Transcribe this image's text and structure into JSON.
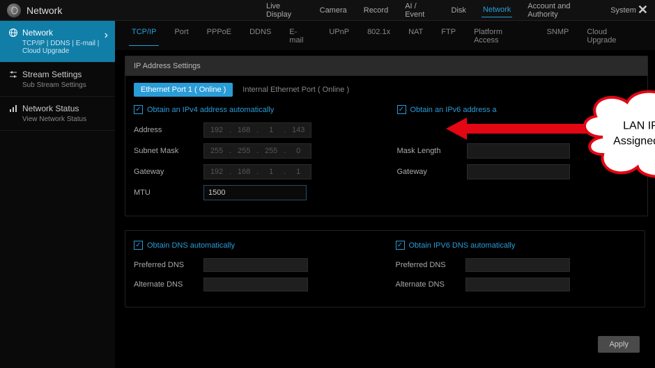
{
  "header": {
    "title": "Network",
    "menu": [
      "Live Display",
      "Camera",
      "Record",
      "AI / Event",
      "Disk",
      "Network",
      "Account and Authority",
      "System"
    ],
    "active_menu": "Network"
  },
  "sidebar": {
    "items": [
      {
        "title": "Network",
        "sub": "TCP/IP | DDNS | E-mail | Cloud Upgrade",
        "active": true,
        "icon": "globe"
      },
      {
        "title": "Stream Settings",
        "sub": "Sub Stream Settings",
        "active": false,
        "icon": "sliders"
      },
      {
        "title": "Network Status",
        "sub": "View Network Status",
        "active": false,
        "icon": "bars"
      }
    ]
  },
  "subtabs": {
    "items": [
      "TCP/IP",
      "Port",
      "PPPoE",
      "DDNS",
      "E-mail",
      "UPnP",
      "802.1x",
      "NAT",
      "FTP",
      "Platform Access",
      "SNMP",
      "Cloud Upgrade"
    ],
    "active": "TCP/IP"
  },
  "panel": {
    "title": "IP Address Settings",
    "port_tabs": {
      "active": "Ethernet Port 1 ( Online )",
      "inactive": "Internal Ethernet Port ( Online )"
    },
    "ipv4": {
      "checkbox": "Obtain an IPv4 address automatically",
      "address_label": "Address",
      "address": [
        "192",
        "168",
        "1",
        "143"
      ],
      "subnet_label": "Subnet Mask",
      "subnet": [
        "255",
        "255",
        "255",
        "0"
      ],
      "gateway_label": "Gateway",
      "gateway": [
        "192",
        "168",
        "1",
        "1"
      ],
      "mtu_label": "MTU",
      "mtu": "1500"
    },
    "ipv6": {
      "checkbox": "Obtain an IPv6 address a",
      "mask_label": "Mask Length",
      "gateway_label": "Gateway"
    }
  },
  "dns": {
    "ipv4": {
      "checkbox": "Obtain DNS automatically",
      "pref_label": "Preferred DNS",
      "alt_label": "Alternate DNS"
    },
    "ipv6": {
      "checkbox": "Obtain IPV6 DNS automatically",
      "pref_label": "Preferred DNS",
      "alt_label": "Alternate DNS"
    }
  },
  "apply": "Apply",
  "annotation": {
    "line1": "LAN IP address",
    "line2": "Assigned by Router"
  }
}
